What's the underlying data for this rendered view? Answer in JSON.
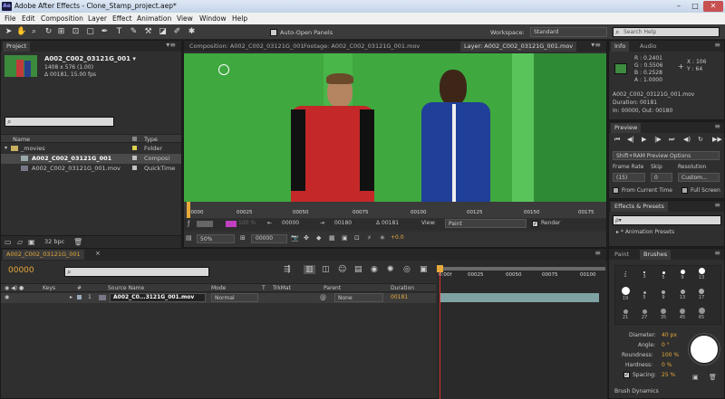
{
  "window": {
    "title": "Adobe After Effects - Clone_Stamp_project.aep*",
    "app_badge": "Ae",
    "controls": [
      "–",
      "□",
      "✕"
    ]
  },
  "menu": [
    "File",
    "Edit",
    "Composition",
    "Layer",
    "Effect",
    "Animation",
    "View",
    "Window",
    "Help"
  ],
  "toolbar": {
    "auto_open_label": "Auto-Open Panels",
    "workspace_label": "Workspace:",
    "workspace_value": "Standard",
    "search_placeholder": "Search Help"
  },
  "project": {
    "tab": "Project",
    "selected_name": "A002_C002_03121G_001 ▾",
    "dims": "1408 x 576 (1.00)",
    "duration": "Δ 00181, 15.00 fps",
    "col_name": "Name",
    "col_type": "Type",
    "items": [
      {
        "name": "_movies",
        "type": "Folder",
        "color": "#e0d050",
        "icon": "folder-icon",
        "indent": 0
      },
      {
        "name": "A002_C002_03121G_001",
        "type": "Composi",
        "color": "#c0c0c0",
        "icon": "composition-icon",
        "indent": 1
      },
      {
        "name": "A002_C002_03121G_001.mov",
        "type": "QuickTime",
        "color": "#c0c0c0",
        "icon": "footage-icon",
        "indent": 1
      }
    ],
    "bpc": "32 bpc"
  },
  "viewer": {
    "tabs": [
      "Composition: A002_C002_03121G_001",
      "Footage: A002_C002_03121G_001.mov",
      "Layer: A002_C002_03121G_001.mov"
    ],
    "ruler": [
      "00000",
      "00025",
      "00050",
      "00075",
      "00100",
      "00125",
      "00150",
      "00175"
    ],
    "start": "00000",
    "end": "00180",
    "duration": "Δ 00181",
    "view_label": "View:",
    "view_value": "Paint",
    "render_label": "Render",
    "zoom": "50%",
    "timecode": "00000",
    "exposure": "+0.0",
    "color_swatch": "#c040c0",
    "percent": "100 %"
  },
  "info": {
    "tabs": [
      "Info",
      "Audio"
    ],
    "r": "R : 0.2401",
    "g": "G : 0.5506",
    "b": "B : 0.2528",
    "a": "A : 1.0000",
    "x": "X : 106",
    "y": "Y : 64",
    "file": "A002_C002_03121G_001.mov",
    "duration": "Duration: 00181",
    "in_out": "In: 00000, Out: 00180"
  },
  "preview": {
    "tab": "Preview",
    "options": "Shift+RAM Preview Options",
    "frame_rate_label": "Frame Rate",
    "frame_rate": "(15)",
    "skip_label": "Skip",
    "skip": "0",
    "resolution_label": "Resolution",
    "resolution": "Custom...",
    "from_current": "From Current Time",
    "full_screen": "Full Screen"
  },
  "effects": {
    "tab": "Effects & Presets",
    "search": "ρ▾",
    "item": "▸ * Animation Presets"
  },
  "brushes": {
    "tabs": [
      "Paint",
      "Brushes"
    ],
    "sizes": [
      "1",
      "3",
      "5",
      "9",
      "13",
      "19",
      "5",
      "9",
      "13",
      "17",
      "21",
      "27",
      "35",
      "45",
      "65"
    ],
    "diameter_label": "Diameter:",
    "diameter": "40 px",
    "angle_label": "Angle:",
    "angle": "0 °",
    "roundness_label": "Roundness:",
    "roundness": "100 %",
    "hardness_label": "Hardness:",
    "hardness": "0 %",
    "spacing_label": "Spacing:",
    "spacing": "25 %",
    "dynamics": "Brush Dynamics"
  },
  "timeline": {
    "tab": "A002_C002_03121G_001",
    "timecode": "00000",
    "cols": [
      "#",
      "Source Name",
      "Mode",
      "T",
      "TrkMat",
      "Parent",
      "Duration"
    ],
    "keys_label": "Keys",
    "layer": {
      "num": "1",
      "name": "A002_C0...3121G_001.mov",
      "mode": "Normal",
      "parent": "None",
      "duration": "00181"
    },
    "ruler": [
      "0:00f",
      "00025",
      "00050",
      "00075",
      "00100"
    ]
  }
}
